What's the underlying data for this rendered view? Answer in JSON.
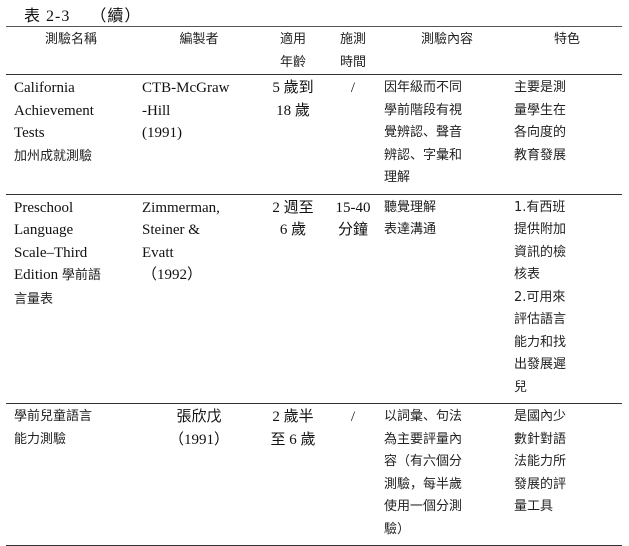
{
  "caption": {
    "table_number": "表 2-3",
    "continued": "（續）"
  },
  "table": {
    "headers": [
      "測驗名稱",
      "編製者",
      "適用\n年齡",
      "施測\n時間",
      "測驗內容",
      "特色"
    ],
    "rows": [
      {
        "name_en": "California\nAchievement\nTests",
        "name_zh": "加州成就測驗",
        "author": "CTB-McGraw\n-Hill\n(1991)",
        "age": "5 歲到\n18 歲",
        "time": "/",
        "content": "因年級而不同\n學前階段有視\n覺辨認、聲音\n辨認、字彙和\n理解",
        "features": "主要是測\n量學生在\n各向度的\n教育發展"
      },
      {
        "name_en": "Preschool\nLanguage\nScale–Third\nEdition",
        "name_zh": "學前語\n言量表",
        "author": "Zimmerman,\nSteiner  &\nEvatt\n（1992）",
        "age": "2 週至\n6 歲",
        "time": "15-40\n分鐘",
        "content": "聽覺理解\n表達溝通",
        "features": "1.有西班\n提供附加\n資訊的檢\n核表\n2.可用來\n評估語言\n能力和找\n出發展遲\n兒"
      },
      {
        "name_en": "",
        "name_zh": "學前兒童語言\n能力測驗",
        "author": "張欣戊\n（1991）",
        "age": "2 歲半\n至 6 歲",
        "time": "/",
        "content": "以詞彙、句法\n為主要評量內\n容（有六個分\n測驗，每半歲\n使用一個分測\n驗）",
        "features": "是國內少\n數針對語\n法能力所\n發展的評\n量工具"
      }
    ]
  }
}
